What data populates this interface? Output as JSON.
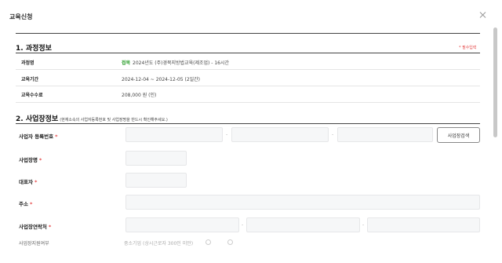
{
  "modal": {
    "title": "교육신청"
  },
  "section1": {
    "title": "1. 과정정보",
    "required_note": "* 필수입력",
    "rows": [
      {
        "label": "과정명",
        "tag": "접목",
        "value": "2024년도 (주)경북지방법교육(제조업) - 16시간"
      },
      {
        "label": "교육기간",
        "value": "2024-12-04 ~ 2024-12-05 (2일간)"
      },
      {
        "label": "교육수수료",
        "value": "208,000 원 (인)"
      }
    ]
  },
  "section2": {
    "title": "2. 사업장정보",
    "subtitle": "(현재소속의 사업자등록번호 및 사업장명을 반드시 확인해주세요.)",
    "fields": {
      "biz_no": {
        "label": "사업자 등록번호",
        "required": "*"
      },
      "biz_name": {
        "label": "사업장명",
        "required": "*"
      },
      "ceo": {
        "label": "대표자",
        "required": "*"
      },
      "address": {
        "label": "주소",
        "required": "*"
      },
      "contact": {
        "label": "사업장연락처",
        "required": "*"
      }
    },
    "dash": "-",
    "search_button": "사업장검색",
    "partial_label": "사업장지원여부",
    "partial_text": "중소기업 (상시근로자 300인 미만)"
  }
}
